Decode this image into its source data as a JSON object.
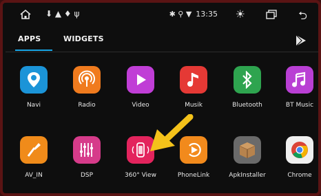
{
  "statusbar": {
    "left_icons": "⬇ ▲ ♦ ψ",
    "time": "13:35",
    "right_icons": "✱ ⚲ ▼"
  },
  "tabs": [
    {
      "label": "APPS"
    },
    {
      "label": "WIDGETS"
    }
  ],
  "apps": [
    {
      "label": "Navi",
      "icon": "map-pin-icon",
      "color": "#1b94d8"
    },
    {
      "label": "Radio",
      "icon": "radio-icon",
      "color": "#f07b1e"
    },
    {
      "label": "Video",
      "icon": "play-icon",
      "color": "#c03ed6"
    },
    {
      "label": "Musik",
      "icon": "music-note-icon",
      "color": "#e53935"
    },
    {
      "label": "Bluetooth",
      "icon": "bluetooth-icon",
      "color": "#2ea44f"
    },
    {
      "label": "BT Music",
      "icon": "music-icon",
      "color": "#b93fd4"
    },
    {
      "label": "AV_IN",
      "icon": "av-plug-icon",
      "color": "#f08b1a"
    },
    {
      "label": "DSP",
      "icon": "equalizer-icon",
      "color": "#d63b8a"
    },
    {
      "label": "360° View",
      "icon": "camera-360-icon",
      "color": "#e3245d"
    },
    {
      "label": "PhoneLink",
      "icon": "phonelink-icon",
      "color": "#f28a1c"
    },
    {
      "label": "ApkInstaller",
      "icon": "package-icon",
      "color": "#6a6a6a"
    },
    {
      "label": "Chrome",
      "icon": "chrome-icon",
      "color": "#efefef"
    }
  ],
  "accent": "#18a6e6",
  "arrow_color": "#f4c21a"
}
